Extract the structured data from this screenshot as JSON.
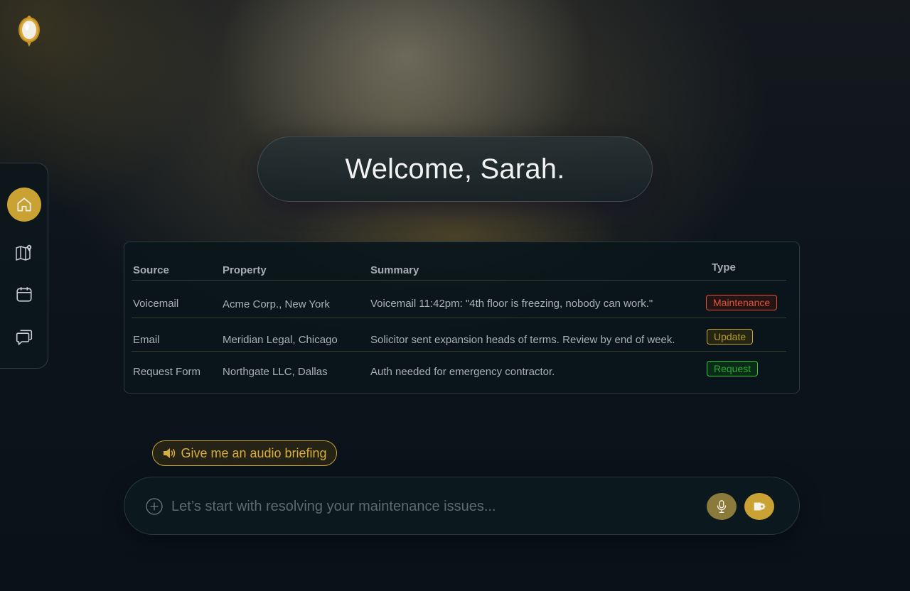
{
  "welcome": {
    "text": "Welcome, Sarah."
  },
  "sidebar": {
    "items": [
      {
        "id": "home",
        "icon": "home-icon",
        "active": true
      },
      {
        "id": "map",
        "icon": "map-pin-icon",
        "active": false
      },
      {
        "id": "calendar",
        "icon": "calendar-icon",
        "active": false
      },
      {
        "id": "messages",
        "icon": "chat-bubbles-icon",
        "active": false
      }
    ]
  },
  "table": {
    "headers": {
      "source": "Source",
      "property": "Property",
      "summary": "Summary",
      "type": "Type"
    },
    "rows": [
      {
        "source": "Voicemail",
        "property": "Acme Corp., New York",
        "summary": "Voicemail 11:42pm: \"4th floor is freezing, nobody can work.\"",
        "type": "Maintenance"
      },
      {
        "source": "Email",
        "property": "Meridian Legal, Chicago",
        "summary": "Solicitor sent expansion heads of terms. Review by end of week.",
        "type": "Update"
      },
      {
        "source": "Request Form",
        "property": "Northgate LLC, Dallas",
        "summary": "Auth needed for emergency contractor.",
        "type": "Request"
      }
    ]
  },
  "audio_chip": {
    "label": "Give me an audio briefing",
    "icon": "speaker-icon"
  },
  "prompt": {
    "placeholder": "Let’s start with resolving your maintenance issues...",
    "value": ""
  },
  "colors": {
    "accent": "#c9a233",
    "maintenance": "#e0533a",
    "update": "#c9a83a",
    "request": "#33c344"
  }
}
